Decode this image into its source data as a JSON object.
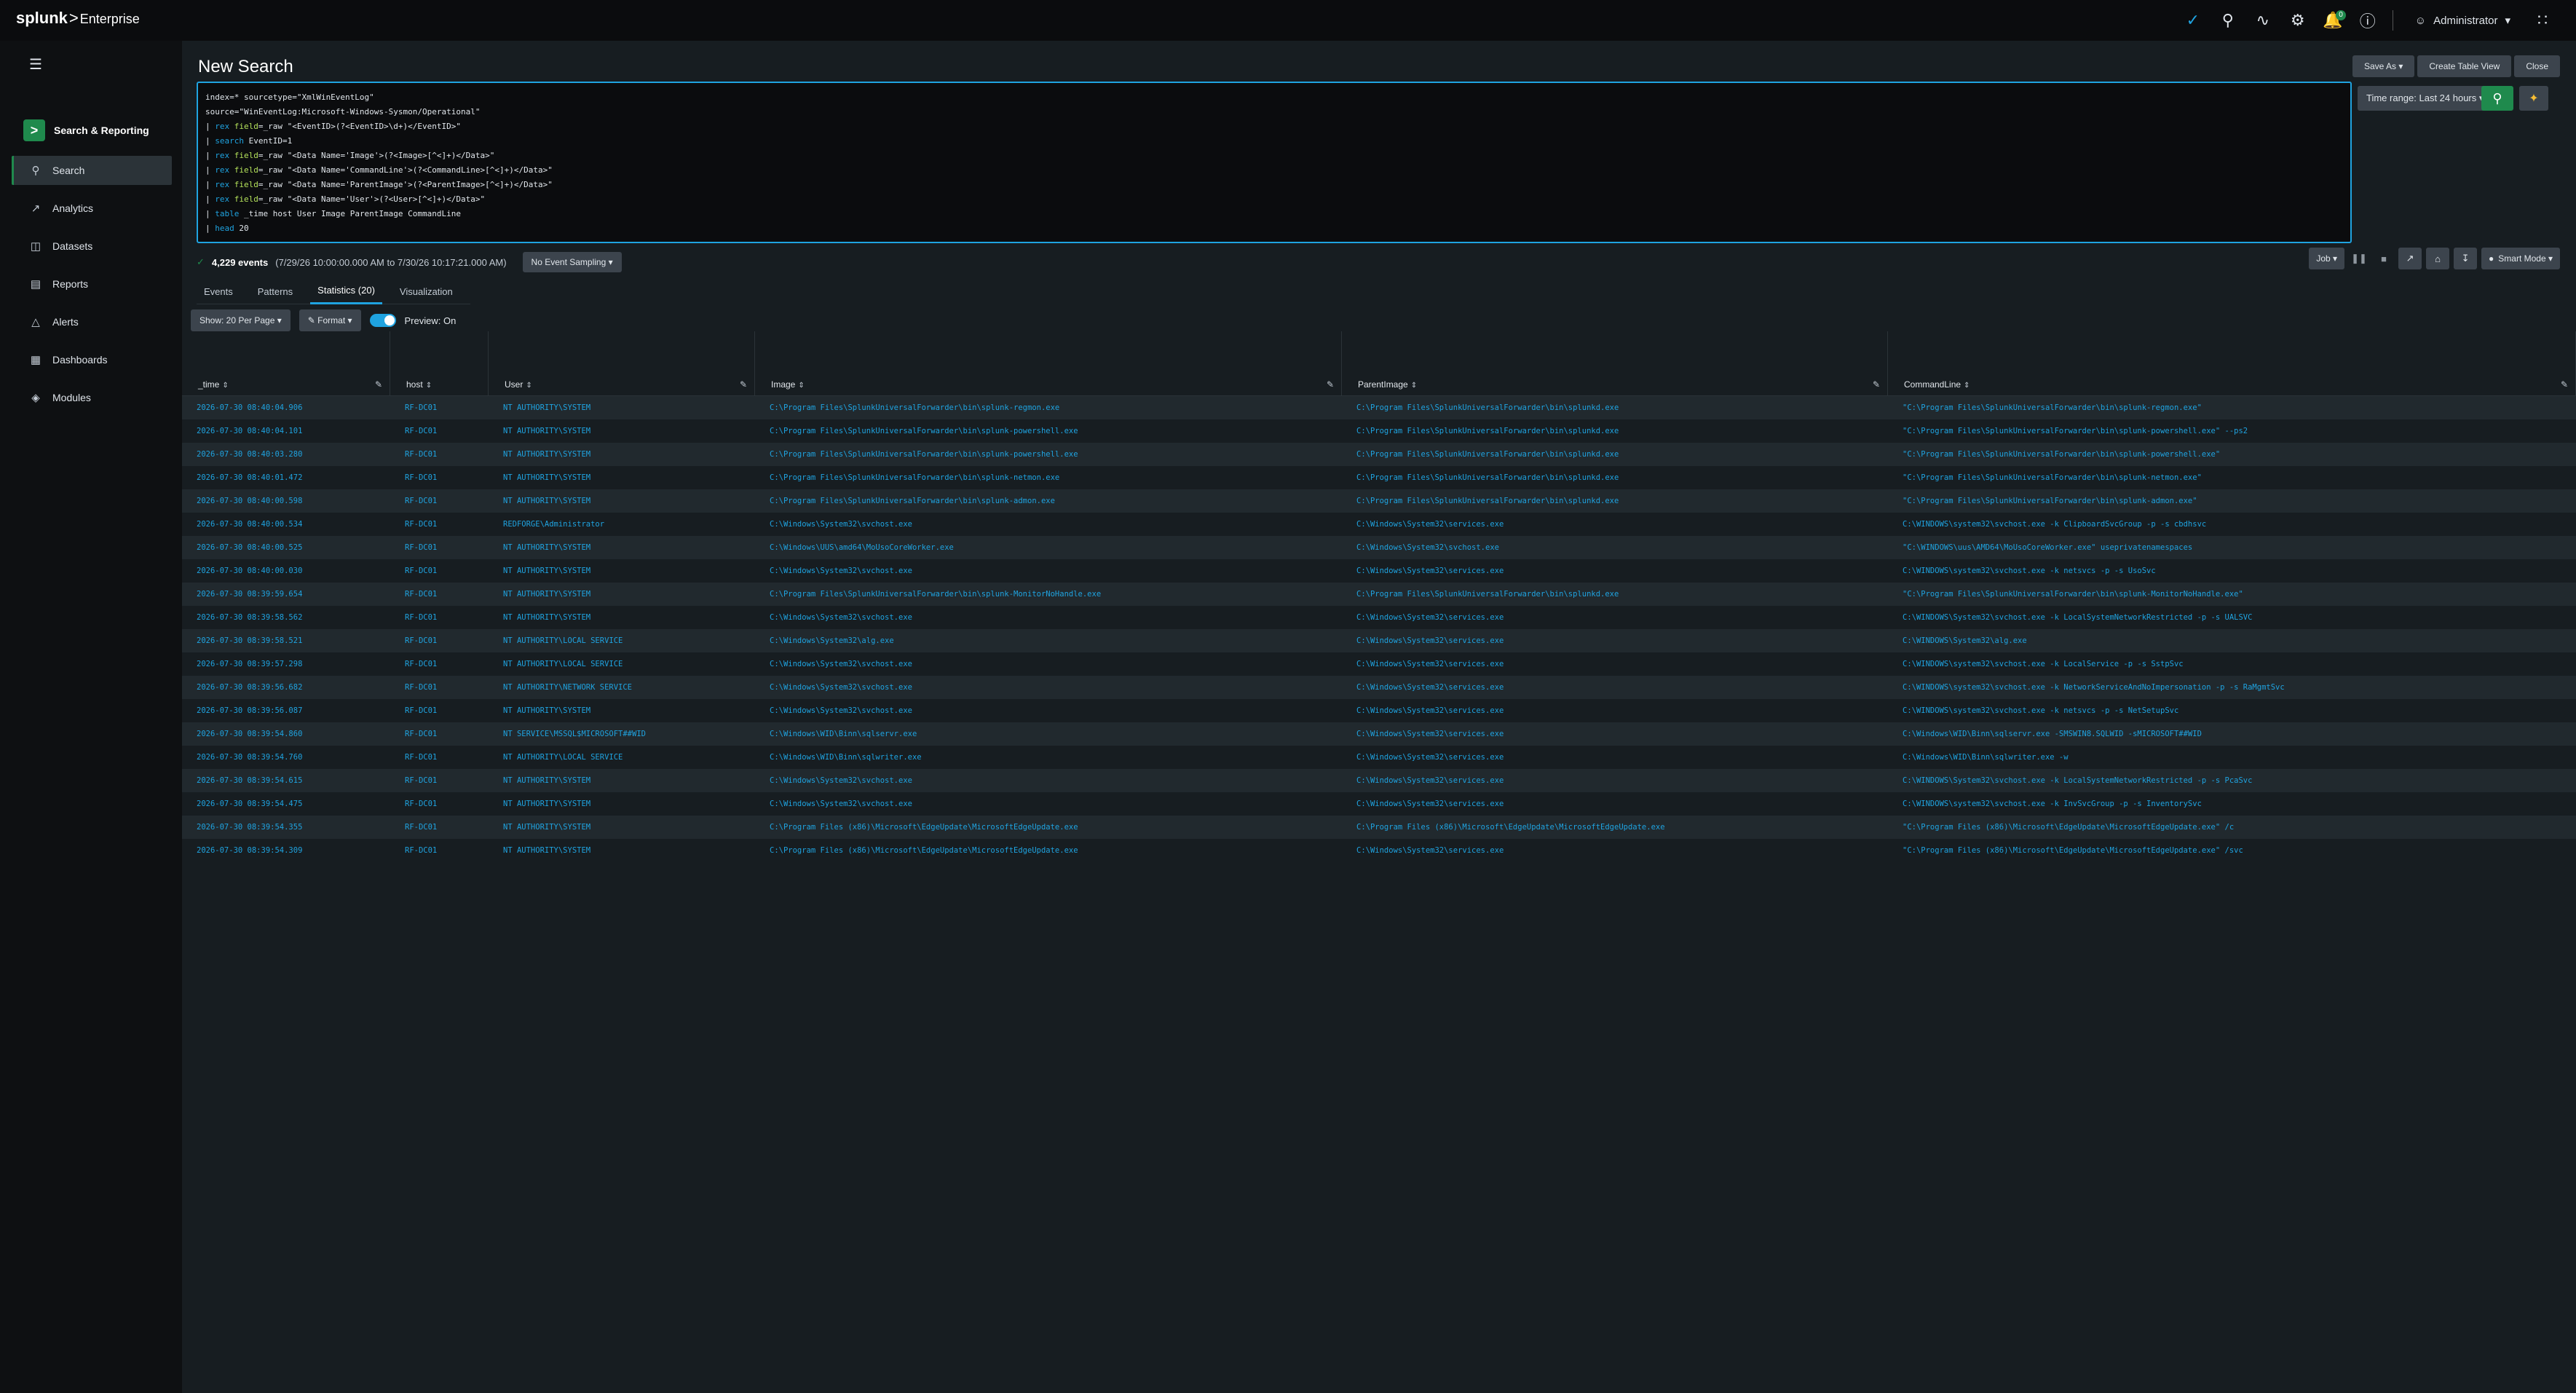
{
  "topbar": {
    "brand": "splunk",
    "product": "Enterprise",
    "notif_count": "0",
    "user": "Administrator"
  },
  "sidebar": {
    "app_name": "Search & Reporting",
    "items": [
      {
        "label": "Search",
        "icon": "search-icon"
      },
      {
        "label": "Analytics",
        "icon": "chart-icon"
      },
      {
        "label": "Datasets",
        "icon": "database-icon"
      },
      {
        "label": "Reports",
        "icon": "document-icon"
      },
      {
        "label": "Alerts",
        "icon": "bell-icon"
      },
      {
        "label": "Dashboards",
        "icon": "grid-icon"
      },
      {
        "label": "Modules",
        "icon": "layers-icon"
      }
    ]
  },
  "header": {
    "title": "New Search",
    "save_as": "Save As ▾",
    "create_table": "Create Table View",
    "close": "Close"
  },
  "search": {
    "lines": [
      {
        "parts": [
          [
            "str",
            "index=* sourcetype=\"XmlWinEventLog\""
          ]
        ]
      },
      {
        "parts": [
          [
            "str",
            "source=\"WinEventLog:Microsoft-Windows-Sysmon/Operational\""
          ]
        ]
      },
      {
        "parts": [
          [
            "str",
            "| "
          ],
          [
            "kw",
            "rex"
          ],
          [
            "str",
            " "
          ],
          [
            "arg",
            "field"
          ],
          [
            "str",
            "=_raw \"<EventID>(?<EventID>\\d+)</EventID>\""
          ]
        ]
      },
      {
        "parts": [
          [
            "str",
            "| "
          ],
          [
            "kw",
            "search"
          ],
          [
            "str",
            " EventID=1"
          ]
        ]
      },
      {
        "parts": [
          [
            "str",
            "| "
          ],
          [
            "kw",
            "rex"
          ],
          [
            "str",
            " "
          ],
          [
            "arg",
            "field"
          ],
          [
            "str",
            "=_raw \"<Data Name='Image'>(?<Image>[^<]+)</Data>\""
          ]
        ]
      },
      {
        "parts": [
          [
            "str",
            "| "
          ],
          [
            "kw",
            "rex"
          ],
          [
            "str",
            " "
          ],
          [
            "arg",
            "field"
          ],
          [
            "str",
            "=_raw \"<Data Name='CommandLine'>(?<CommandLine>[^<]+)</Data>\""
          ]
        ]
      },
      {
        "parts": [
          [
            "str",
            "| "
          ],
          [
            "kw",
            "rex"
          ],
          [
            "str",
            " "
          ],
          [
            "arg",
            "field"
          ],
          [
            "str",
            "=_raw \"<Data Name='ParentImage'>(?<ParentImage>[^<]+)</Data>\""
          ]
        ]
      },
      {
        "parts": [
          [
            "str",
            "| "
          ],
          [
            "kw",
            "rex"
          ],
          [
            "str",
            " "
          ],
          [
            "arg",
            "field"
          ],
          [
            "str",
            "=_raw \"<Data Name='User'>(?<User>[^<]+)</Data>\""
          ]
        ]
      },
      {
        "parts": [
          [
            "str",
            "| "
          ],
          [
            "kw",
            "table"
          ],
          [
            "str",
            " _time host User Image ParentImage CommandLine"
          ]
        ]
      },
      {
        "parts": [
          [
            "str",
            "| "
          ],
          [
            "kw",
            "head"
          ],
          [
            "str",
            " 20"
          ]
        ]
      }
    ],
    "time_range": "Time range: Last 24 hours ▾"
  },
  "status": {
    "count": "4,229 events",
    "range": "(7/29/26 10:00:00.000 AM to 7/30/26 10:17:21.000 AM)",
    "sampling": "No Event Sampling ▾",
    "job": "Job ▾",
    "mode": "Smart Mode ▾"
  },
  "tabs": [
    "Events",
    "Patterns",
    "Statistics (20)",
    "Visualization"
  ],
  "options": {
    "per_page": "Show: 20 Per Page ▾",
    "format": "✎ Format ▾",
    "preview": "Preview: On"
  },
  "table": {
    "columns": [
      "_time",
      "host",
      "User",
      "Image",
      "ParentImage",
      "CommandLine"
    ],
    "rows": [
      [
        "2026-07-30 08:40:04.906",
        "RF-DC01",
        "NT AUTHORITY\\SYSTEM",
        "C:\\Program Files\\SplunkUniversalForwarder\\bin\\splunk-regmon.exe",
        "C:\\Program Files\\SplunkUniversalForwarder\\bin\\splunkd.exe",
        "\"C:\\Program Files\\SplunkUniversalForwarder\\bin\\splunk-regmon.exe\""
      ],
      [
        "2026-07-30 08:40:04.101",
        "RF-DC01",
        "NT AUTHORITY\\SYSTEM",
        "C:\\Program Files\\SplunkUniversalForwarder\\bin\\splunk-powershell.exe",
        "C:\\Program Files\\SplunkUniversalForwarder\\bin\\splunkd.exe",
        "\"C:\\Program Files\\SplunkUniversalForwarder\\bin\\splunk-powershell.exe\" --ps2"
      ],
      [
        "2026-07-30 08:40:03.280",
        "RF-DC01",
        "NT AUTHORITY\\SYSTEM",
        "C:\\Program Files\\SplunkUniversalForwarder\\bin\\splunk-powershell.exe",
        "C:\\Program Files\\SplunkUniversalForwarder\\bin\\splunkd.exe",
        "\"C:\\Program Files\\SplunkUniversalForwarder\\bin\\splunk-powershell.exe\""
      ],
      [
        "2026-07-30 08:40:01.472",
        "RF-DC01",
        "NT AUTHORITY\\SYSTEM",
        "C:\\Program Files\\SplunkUniversalForwarder\\bin\\splunk-netmon.exe",
        "C:\\Program Files\\SplunkUniversalForwarder\\bin\\splunkd.exe",
        "\"C:\\Program Files\\SplunkUniversalForwarder\\bin\\splunk-netmon.exe\""
      ],
      [
        "2026-07-30 08:40:00.598",
        "RF-DC01",
        "NT AUTHORITY\\SYSTEM",
        "C:\\Program Files\\SplunkUniversalForwarder\\bin\\splunk-admon.exe",
        "C:\\Program Files\\SplunkUniversalForwarder\\bin\\splunkd.exe",
        "\"C:\\Program Files\\SplunkUniversalForwarder\\bin\\splunk-admon.exe\""
      ],
      [
        "2026-07-30 08:40:00.534",
        "RF-DC01",
        "REDFORGE\\Administrator",
        "C:\\Windows\\System32\\svchost.exe",
        "C:\\Windows\\System32\\services.exe",
        "C:\\WINDOWS\\system32\\svchost.exe -k ClipboardSvcGroup -p -s cbdhsvc"
      ],
      [
        "2026-07-30 08:40:00.525",
        "RF-DC01",
        "NT AUTHORITY\\SYSTEM",
        "C:\\Windows\\UUS\\amd64\\MoUsoCoreWorker.exe",
        "C:\\Windows\\System32\\svchost.exe",
        "\"C:\\WINDOWS\\uus\\AMD64\\MoUsoCoreWorker.exe\" useprivatenamespaces"
      ],
      [
        "2026-07-30 08:40:00.030",
        "RF-DC01",
        "NT AUTHORITY\\SYSTEM",
        "C:\\Windows\\System32\\svchost.exe",
        "C:\\Windows\\System32\\services.exe",
        "C:\\WINDOWS\\system32\\svchost.exe -k netsvcs -p -s UsoSvc"
      ],
      [
        "2026-07-30 08:39:59.654",
        "RF-DC01",
        "NT AUTHORITY\\SYSTEM",
        "C:\\Program Files\\SplunkUniversalForwarder\\bin\\splunk-MonitorNoHandle.exe",
        "C:\\Program Files\\SplunkUniversalForwarder\\bin\\splunkd.exe",
        "\"C:\\Program Files\\SplunkUniversalForwarder\\bin\\splunk-MonitorNoHandle.exe\""
      ],
      [
        "2026-07-30 08:39:58.562",
        "RF-DC01",
        "NT AUTHORITY\\SYSTEM",
        "C:\\Windows\\System32\\svchost.exe",
        "C:\\Windows\\System32\\services.exe",
        "C:\\WINDOWS\\System32\\svchost.exe -k LocalSystemNetworkRestricted -p -s UALSVC"
      ],
      [
        "2026-07-30 08:39:58.521",
        "RF-DC01",
        "NT AUTHORITY\\LOCAL SERVICE",
        "C:\\Windows\\System32\\alg.exe",
        "C:\\Windows\\System32\\services.exe",
        "C:\\WINDOWS\\System32\\alg.exe"
      ],
      [
        "2026-07-30 08:39:57.298",
        "RF-DC01",
        "NT AUTHORITY\\LOCAL SERVICE",
        "C:\\Windows\\System32\\svchost.exe",
        "C:\\Windows\\System32\\services.exe",
        "C:\\WINDOWS\\system32\\svchost.exe -k LocalService -p -s SstpSvc"
      ],
      [
        "2026-07-30 08:39:56.682",
        "RF-DC01",
        "NT AUTHORITY\\NETWORK SERVICE",
        "C:\\Windows\\System32\\svchost.exe",
        "C:\\Windows\\System32\\services.exe",
        "C:\\WINDOWS\\system32\\svchost.exe -k NetworkServiceAndNoImpersonation -p -s RaMgmtSvc"
      ],
      [
        "2026-07-30 08:39:56.087",
        "RF-DC01",
        "NT AUTHORITY\\SYSTEM",
        "C:\\Windows\\System32\\svchost.exe",
        "C:\\Windows\\System32\\services.exe",
        "C:\\WINDOWS\\system32\\svchost.exe -k netsvcs -p -s NetSetupSvc"
      ],
      [
        "2026-07-30 08:39:54.860",
        "RF-DC01",
        "NT SERVICE\\MSSQL$MICROSOFT##WID",
        "C:\\Windows\\WID\\Binn\\sqlservr.exe",
        "C:\\Windows\\System32\\services.exe",
        "C:\\Windows\\WID\\Binn\\sqlservr.exe -SMSWIN8.SQLWID -sMICROSOFT##WID"
      ],
      [
        "2026-07-30 08:39:54.760",
        "RF-DC01",
        "NT AUTHORITY\\LOCAL SERVICE",
        "C:\\Windows\\WID\\Binn\\sqlwriter.exe",
        "C:\\Windows\\System32\\services.exe",
        "C:\\Windows\\WID\\Binn\\sqlwriter.exe -w"
      ],
      [
        "2026-07-30 08:39:54.615",
        "RF-DC01",
        "NT AUTHORITY\\SYSTEM",
        "C:\\Windows\\System32\\svchost.exe",
        "C:\\Windows\\System32\\services.exe",
        "C:\\WINDOWS\\System32\\svchost.exe -k LocalSystemNetworkRestricted -p -s PcaSvc"
      ],
      [
        "2026-07-30 08:39:54.475",
        "RF-DC01",
        "NT AUTHORITY\\SYSTEM",
        "C:\\Windows\\System32\\svchost.exe",
        "C:\\Windows\\System32\\services.exe",
        "C:\\WINDOWS\\system32\\svchost.exe -k InvSvcGroup -p -s InventorySvc"
      ],
      [
        "2026-07-30 08:39:54.355",
        "RF-DC01",
        "NT AUTHORITY\\SYSTEM",
        "C:\\Program Files (x86)\\Microsoft\\EdgeUpdate\\MicrosoftEdgeUpdate.exe",
        "C:\\Program Files (x86)\\Microsoft\\EdgeUpdate\\MicrosoftEdgeUpdate.exe",
        "\"C:\\Program Files (x86)\\Microsoft\\EdgeUpdate\\MicrosoftEdgeUpdate.exe\" /c"
      ],
      [
        "2026-07-30 08:39:54.309",
        "RF-DC01",
        "NT AUTHORITY\\SYSTEM",
        "C:\\Program Files (x86)\\Microsoft\\EdgeUpdate\\MicrosoftEdgeUpdate.exe",
        "C:\\Windows\\System32\\services.exe",
        "\"C:\\Program Files (x86)\\Microsoft\\EdgeUpdate\\MicrosoftEdgeUpdate.exe\" /svc"
      ]
    ]
  }
}
